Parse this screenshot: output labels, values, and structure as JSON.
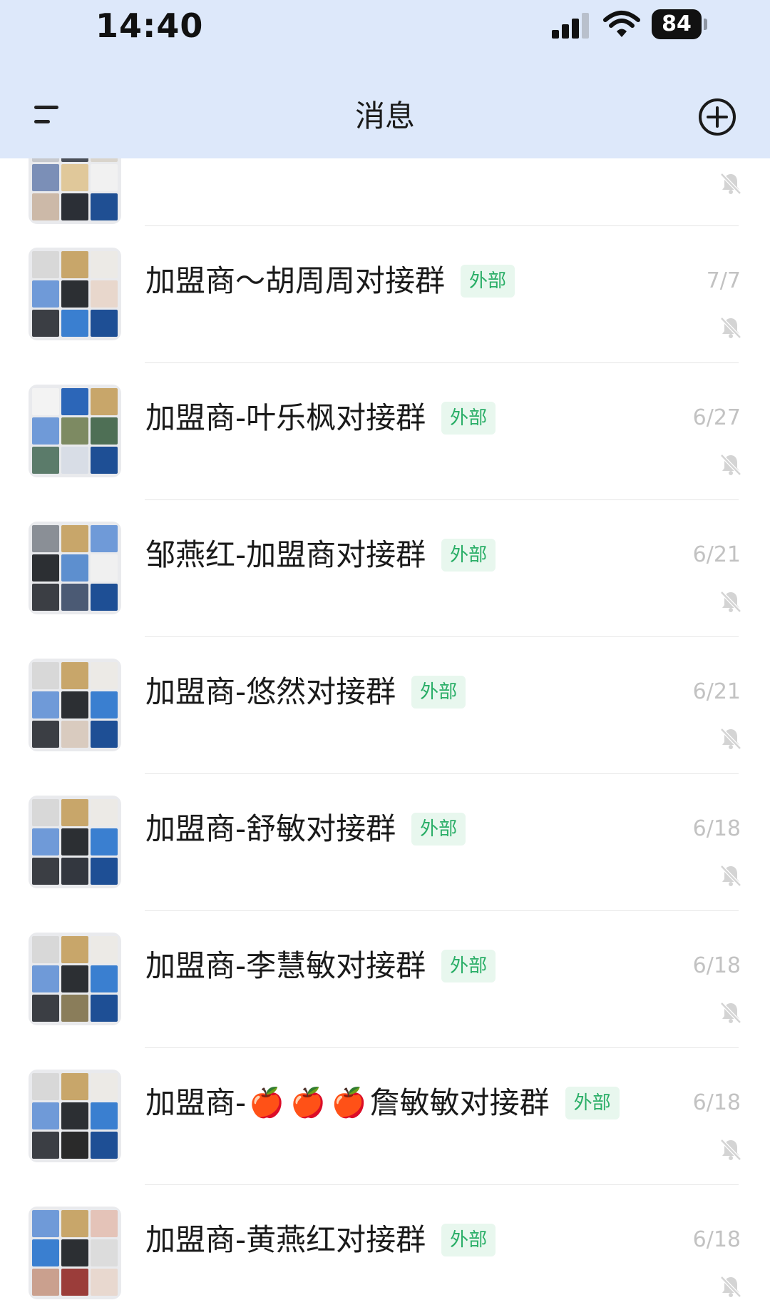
{
  "status_bar": {
    "time": "14:40",
    "battery": "84"
  },
  "header": {
    "title": "消息"
  },
  "ext_tag": "外部",
  "rows": [
    {
      "title": "加盟商～胡周周对接群",
      "date": "7/7"
    },
    {
      "title": "加盟商-叶乐枫对接群",
      "date": "6/27"
    },
    {
      "title": "邹燕红-加盟商对接群",
      "date": "6/21"
    },
    {
      "title": "加盟商-悠然对接群",
      "date": "6/21"
    },
    {
      "title": "加盟商-舒敏对接群",
      "date": "6/18"
    },
    {
      "title": "加盟商-李慧敏对接群",
      "date": "6/18"
    },
    {
      "title_before": "加盟商-",
      "emoji": "🍎",
      "title_after": "詹敏敏对接群",
      "date": "6/18"
    },
    {
      "title": "加盟商-黄燕红对接群",
      "date": "6/18"
    }
  ],
  "colors": {
    "header_bg": "#dde8fa",
    "tag_bg": "#e8f7ee",
    "tag_text": "#2aae67",
    "date": "#c2c2c2"
  },
  "icons": [
    "menu-icon",
    "add-circle-icon",
    "mute-bell-icon",
    "signal-icon",
    "wifi-icon",
    "battery-icon"
  ]
}
